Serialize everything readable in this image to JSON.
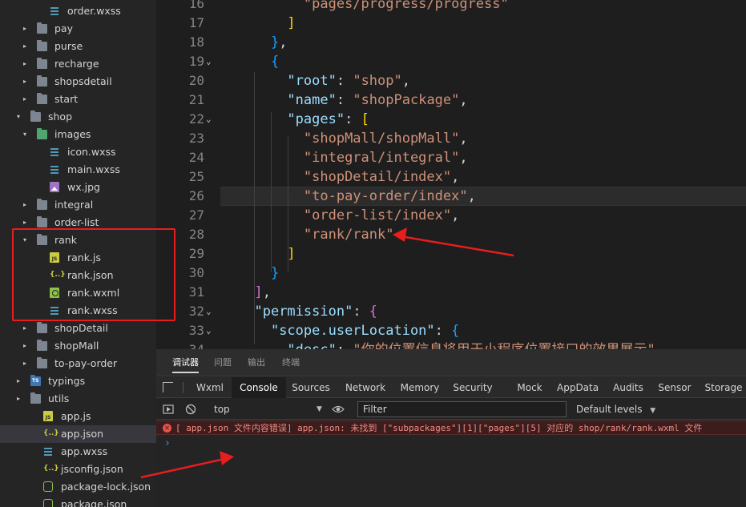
{
  "explorer": {
    "items": [
      {
        "label": "order.wxss",
        "kind": "file",
        "icon": "wxss-file-icon"
      },
      {
        "label": "pay",
        "kind": "folder",
        "icon": "folder-icon",
        "expanded": false
      },
      {
        "label": "purse",
        "kind": "folder",
        "icon": "folder-icon",
        "expanded": false
      },
      {
        "label": "recharge",
        "kind": "folder",
        "icon": "folder-icon",
        "expanded": false
      },
      {
        "label": "shopsdetail",
        "kind": "folder",
        "icon": "folder-icon",
        "expanded": false
      },
      {
        "label": "start",
        "kind": "folder",
        "icon": "folder-icon",
        "expanded": false
      },
      {
        "label": "shop",
        "kind": "folder",
        "icon": "folder-icon",
        "expanded": true
      },
      {
        "label": "images",
        "kind": "folder",
        "icon": "image-folder-icon",
        "expanded": true
      },
      {
        "label": "icon.wxss",
        "kind": "file",
        "icon": "wxss-file-icon"
      },
      {
        "label": "main.wxss",
        "kind": "file",
        "icon": "wxss-file-icon"
      },
      {
        "label": "wx.jpg",
        "kind": "file",
        "icon": "image-file-icon"
      },
      {
        "label": "integral",
        "kind": "folder",
        "icon": "folder-icon",
        "expanded": false
      },
      {
        "label": "order-list",
        "kind": "folder",
        "icon": "folder-icon",
        "expanded": false
      },
      {
        "label": "rank",
        "kind": "folder",
        "icon": "folder-icon",
        "expanded": true
      },
      {
        "label": "rank.js",
        "kind": "file",
        "icon": "js-file-icon"
      },
      {
        "label": "rank.json",
        "kind": "file",
        "icon": "json-file-icon"
      },
      {
        "label": "rank.wxml",
        "kind": "file",
        "icon": "wxml-file-icon"
      },
      {
        "label": "rank.wxss",
        "kind": "file",
        "icon": "wxss-file-icon"
      },
      {
        "label": "shopDetail",
        "kind": "folder",
        "icon": "folder-icon",
        "expanded": false
      },
      {
        "label": "shopMall",
        "kind": "folder",
        "icon": "folder-icon",
        "expanded": false
      },
      {
        "label": "to-pay-order",
        "kind": "folder",
        "icon": "folder-icon",
        "expanded": false
      },
      {
        "label": "typings",
        "kind": "folder",
        "icon": "typescript-folder-icon",
        "expanded": false
      },
      {
        "label": "utils",
        "kind": "folder",
        "icon": "folder-icon",
        "expanded": false
      },
      {
        "label": "app.js",
        "kind": "file",
        "icon": "js-file-icon"
      },
      {
        "label": "app.json",
        "kind": "file",
        "icon": "json-file-icon",
        "selected": true
      },
      {
        "label": "app.wxss",
        "kind": "file",
        "icon": "wxss-file-icon"
      },
      {
        "label": "jsconfig.json",
        "kind": "file",
        "icon": "json-file-icon"
      },
      {
        "label": "package-lock.json",
        "kind": "file",
        "icon": "node-file-icon"
      },
      {
        "label": "package.json",
        "kind": "file",
        "icon": "node-file-icon"
      }
    ],
    "highlight_color": "#e81d1d"
  },
  "editor": {
    "lines": [
      {
        "n": "16",
        "fold": "",
        "tokens": [
          {
            "t": "        ",
            "c": "punc"
          },
          {
            "t": "\"pages/progress/progress\"",
            "c": "str"
          }
        ]
      },
      {
        "n": "17",
        "fold": "",
        "tokens": [
          {
            "t": "      ",
            "c": "punc"
          },
          {
            "t": "]",
            "c": "b1"
          }
        ]
      },
      {
        "n": "18",
        "fold": "",
        "tokens": [
          {
            "t": "    ",
            "c": "punc"
          },
          {
            "t": "}",
            "c": "b3"
          },
          {
            "t": ",",
            "c": "punc"
          }
        ]
      },
      {
        "n": "19",
        "fold": "v",
        "tokens": [
          {
            "t": "    ",
            "c": "punc"
          },
          {
            "t": "{",
            "c": "b3"
          }
        ]
      },
      {
        "n": "20",
        "fold": "",
        "tokens": [
          {
            "t": "      ",
            "c": "punc"
          },
          {
            "t": "\"root\"",
            "c": "key"
          },
          {
            "t": ": ",
            "c": "punc"
          },
          {
            "t": "\"shop\"",
            "c": "str"
          },
          {
            "t": ",",
            "c": "punc"
          }
        ]
      },
      {
        "n": "21",
        "fold": "",
        "tokens": [
          {
            "t": "      ",
            "c": "punc"
          },
          {
            "t": "\"name\"",
            "c": "key"
          },
          {
            "t": ": ",
            "c": "punc"
          },
          {
            "t": "\"shopPackage\"",
            "c": "str"
          },
          {
            "t": ",",
            "c": "punc"
          }
        ]
      },
      {
        "n": "22",
        "fold": "v",
        "tokens": [
          {
            "t": "      ",
            "c": "punc"
          },
          {
            "t": "\"pages\"",
            "c": "key"
          },
          {
            "t": ": ",
            "c": "punc"
          },
          {
            "t": "[",
            "c": "b1"
          }
        ]
      },
      {
        "n": "23",
        "fold": "",
        "tokens": [
          {
            "t": "        ",
            "c": "punc"
          },
          {
            "t": "\"shopMall/shopMall\"",
            "c": "str"
          },
          {
            "t": ",",
            "c": "punc"
          }
        ]
      },
      {
        "n": "24",
        "fold": "",
        "tokens": [
          {
            "t": "        ",
            "c": "punc"
          },
          {
            "t": "\"integral/integral\"",
            "c": "str"
          },
          {
            "t": ",",
            "c": "punc"
          }
        ]
      },
      {
        "n": "25",
        "fold": "",
        "tokens": [
          {
            "t": "        ",
            "c": "punc"
          },
          {
            "t": "\"shopDetail/index\"",
            "c": "str"
          },
          {
            "t": ",",
            "c": "punc"
          }
        ]
      },
      {
        "n": "26",
        "fold": "",
        "tokens": [
          {
            "t": "        ",
            "c": "punc"
          },
          {
            "t": "\"to-pay-order/index\"",
            "c": "str"
          },
          {
            "t": ",",
            "c": "punc"
          }
        ]
      },
      {
        "n": "27",
        "fold": "",
        "tokens": [
          {
            "t": "        ",
            "c": "punc"
          },
          {
            "t": "\"order-list/index\"",
            "c": "str"
          },
          {
            "t": ",",
            "c": "punc"
          }
        ]
      },
      {
        "n": "28",
        "fold": "",
        "tokens": [
          {
            "t": "        ",
            "c": "punc"
          },
          {
            "t": "\"rank/rank\"",
            "c": "str"
          }
        ]
      },
      {
        "n": "29",
        "fold": "",
        "tokens": [
          {
            "t": "      ",
            "c": "punc"
          },
          {
            "t": "]",
            "c": "b1"
          }
        ]
      },
      {
        "n": "30",
        "fold": "",
        "tokens": [
          {
            "t": "    ",
            "c": "punc"
          },
          {
            "t": "}",
            "c": "b3"
          }
        ]
      },
      {
        "n": "31",
        "fold": "",
        "tokens": [
          {
            "t": "  ",
            "c": "punc"
          },
          {
            "t": "]",
            "c": "b2"
          },
          {
            "t": ",",
            "c": "punc"
          }
        ]
      },
      {
        "n": "32",
        "fold": "v",
        "tokens": [
          {
            "t": "  ",
            "c": "punc"
          },
          {
            "t": "\"permission\"",
            "c": "key"
          },
          {
            "t": ": ",
            "c": "punc"
          },
          {
            "t": "{",
            "c": "b2"
          }
        ]
      },
      {
        "n": "33",
        "fold": "v",
        "tokens": [
          {
            "t": "    ",
            "c": "punc"
          },
          {
            "t": "\"scope.userLocation\"",
            "c": "key"
          },
          {
            "t": ": ",
            "c": "punc"
          },
          {
            "t": "{",
            "c": "b3"
          }
        ]
      },
      {
        "n": "34",
        "fold": "",
        "tokens": [
          {
            "t": "      ",
            "c": "punc"
          },
          {
            "t": "\"desc\"",
            "c": "key"
          },
          {
            "t": ": ",
            "c": "punc"
          },
          {
            "t": "\"你的位置信息将用于小程序位置接口的效果展示\"",
            "c": "str"
          }
        ]
      }
    ],
    "current_line": "26"
  },
  "devtools": {
    "panel_tabs": [
      "调试器",
      "问题",
      "输出",
      "终端"
    ],
    "active_panel": "调试器",
    "tabs": [
      "Wxml",
      "Console",
      "Sources",
      "Network",
      "Memory",
      "Security",
      "Mock",
      "AppData",
      "Audits",
      "Sensor",
      "Storage"
    ],
    "active_tab": "Console",
    "toolbar": {
      "context": "top",
      "filter_placeholder": "Filter",
      "levels": "Default levels"
    },
    "error_message": "[ app.json 文件内容错误] app.json: 未找到 [\"subpackages\"][1][\"pages\"][5] 对应的 shop/rank/rank.wxml 文件",
    "prompt": "›"
  },
  "colors": {
    "accent_error": "#e5534b",
    "annotation_red": "#e81d1d"
  }
}
